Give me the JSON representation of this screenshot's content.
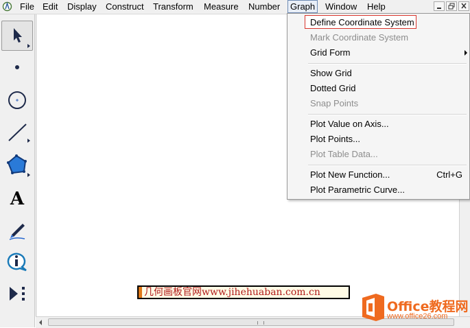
{
  "menubar": {
    "items": [
      "File",
      "Edit",
      "Display",
      "Construct",
      "Transform",
      "Measure",
      "Number",
      "Graph",
      "Window",
      "Help"
    ],
    "active": "Graph"
  },
  "window_controls": [
    "minimize",
    "restore",
    "close"
  ],
  "toolbar": {
    "tools": [
      "arrow-tool",
      "point-tool",
      "compass-tool",
      "straightedge-tool",
      "polygon-tool",
      "text-tool",
      "marker-tool",
      "information-tool",
      "custom-tool"
    ],
    "selected": "arrow-tool",
    "text_tool_glyph": "A"
  },
  "graph_menu": {
    "items": [
      {
        "label": "Define Coordinate System",
        "enabled": true,
        "highlighted": true
      },
      {
        "label": "Mark Coordinate System",
        "enabled": false
      },
      {
        "label": "Grid Form",
        "enabled": true,
        "submenu": true
      },
      {
        "label": "Show Grid",
        "enabled": true
      },
      {
        "label": "Dotted Grid",
        "enabled": true
      },
      {
        "label": "Snap Points",
        "enabled": false
      },
      {
        "label": "Plot Value on Axis...",
        "enabled": true
      },
      {
        "label": "Plot Points...",
        "enabled": true
      },
      {
        "label": "Plot Table Data...",
        "enabled": false
      },
      {
        "label": "Plot New Function...",
        "enabled": true,
        "shortcut": "Ctrl+G"
      },
      {
        "label": "Plot Parametric Curve...",
        "enabled": true
      }
    ]
  },
  "watermark": "几何画板官网www.jihehuaban.com.cn",
  "logo": {
    "title": "Office教程网",
    "url": "www.office26.com",
    "color": "#ef6a1f"
  }
}
